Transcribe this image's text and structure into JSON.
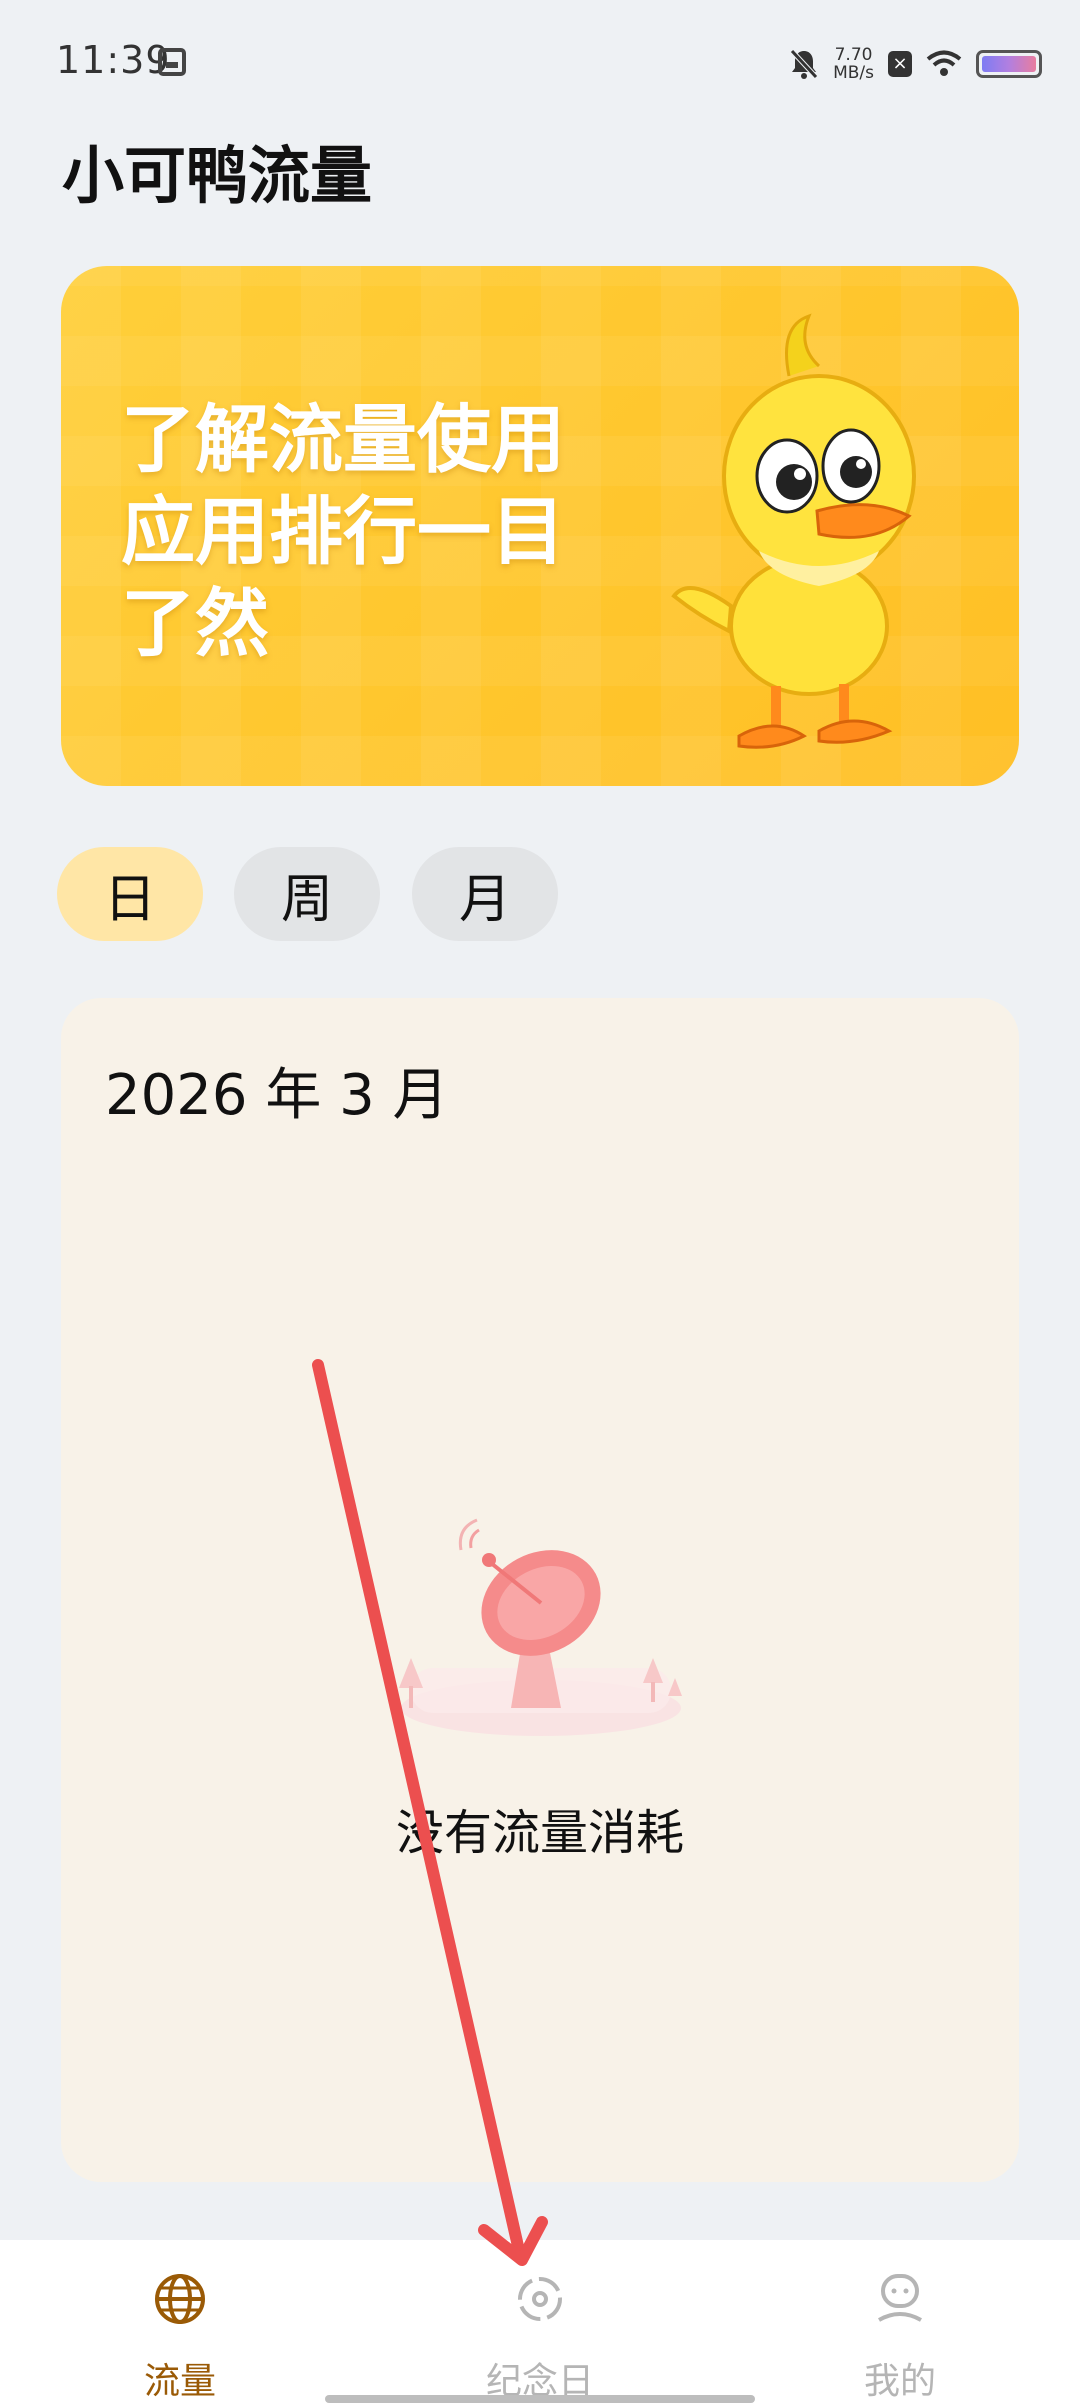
{
  "status_bar": {
    "time": "11:39",
    "net_speed_value": "7.70",
    "net_speed_unit": "MB/s"
  },
  "app": {
    "title": "小可鸭流量"
  },
  "banner": {
    "line1": "了解流量使用",
    "line2": "应用排行一目",
    "line3": "了然"
  },
  "period_tabs": [
    {
      "label": "日",
      "selected": true
    },
    {
      "label": "周",
      "selected": false
    },
    {
      "label": "月",
      "selected": false
    }
  ],
  "usage_card": {
    "date_label": "2026 年 3 月",
    "empty_message": "没有流量消耗"
  },
  "bottom_nav": [
    {
      "label": "流量",
      "icon": "globe-icon",
      "active": true
    },
    {
      "label": "纪念日",
      "icon": "anniversary-icon",
      "active": false
    },
    {
      "label": "我的",
      "icon": "profile-icon",
      "active": false
    }
  ],
  "colors": {
    "accent": "#9a5a06",
    "tab_active_bg": "#ffe6a6",
    "tab_inactive_bg": "#e2e4e6",
    "card_bg": "#f8f2e8",
    "banner_yellow": "#ffc72e",
    "arrow_red": "#ec4f4f"
  }
}
